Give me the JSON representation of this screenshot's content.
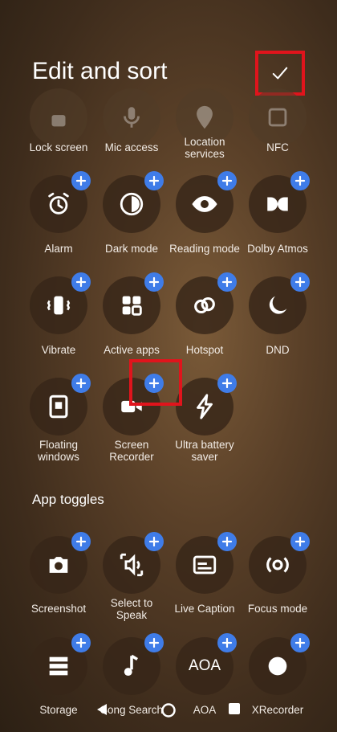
{
  "header": {
    "title": "Edit and sort"
  },
  "rows_top": [
    {
      "label": "Lock screen",
      "icon": "lock-screen-icon"
    },
    {
      "label": "Mic access",
      "icon": "mic-icon"
    },
    {
      "label": "Location services",
      "icon": "location-icon"
    },
    {
      "label": "NFC",
      "icon": "nfc-icon"
    }
  ],
  "tiles": [
    {
      "label": "Alarm",
      "icon": "alarm-icon"
    },
    {
      "label": "Dark mode",
      "icon": "dark-mode-icon"
    },
    {
      "label": "Reading mode",
      "icon": "eye-icon"
    },
    {
      "label": "Dolby Atmos",
      "icon": "dolby-icon"
    },
    {
      "label": "Vibrate",
      "icon": "vibrate-icon"
    },
    {
      "label": "Active apps",
      "icon": "grid-icon"
    },
    {
      "label": "Hotspot",
      "icon": "hotspot-icon"
    },
    {
      "label": "DND",
      "icon": "moon-icon"
    },
    {
      "label": "Floating windows",
      "icon": "floating-window-icon"
    },
    {
      "label": "Screen Recorder",
      "icon": "video-camera-icon"
    },
    {
      "label": "Ultra battery saver",
      "icon": "lightning-icon"
    }
  ],
  "app_toggles": {
    "title": "App toggles",
    "items": [
      {
        "label": "Screenshot",
        "icon": "camera-icon"
      },
      {
        "label": "Select to Speak",
        "icon": "speaker-icon"
      },
      {
        "label": "Live Caption",
        "icon": "caption-icon"
      },
      {
        "label": "Focus mode",
        "icon": "focus-icon"
      },
      {
        "label": "Storage",
        "icon": "storage-icon"
      },
      {
        "label": "Song Search",
        "icon": "music-note-icon"
      },
      {
        "label": "AOA",
        "icon": "aoa-icon",
        "icon_text": "AOA"
      },
      {
        "label": "XRecorder",
        "icon": "record-icon"
      }
    ]
  },
  "colors": {
    "add_badge": "#3f7ce8",
    "highlight": "#e0141c"
  }
}
